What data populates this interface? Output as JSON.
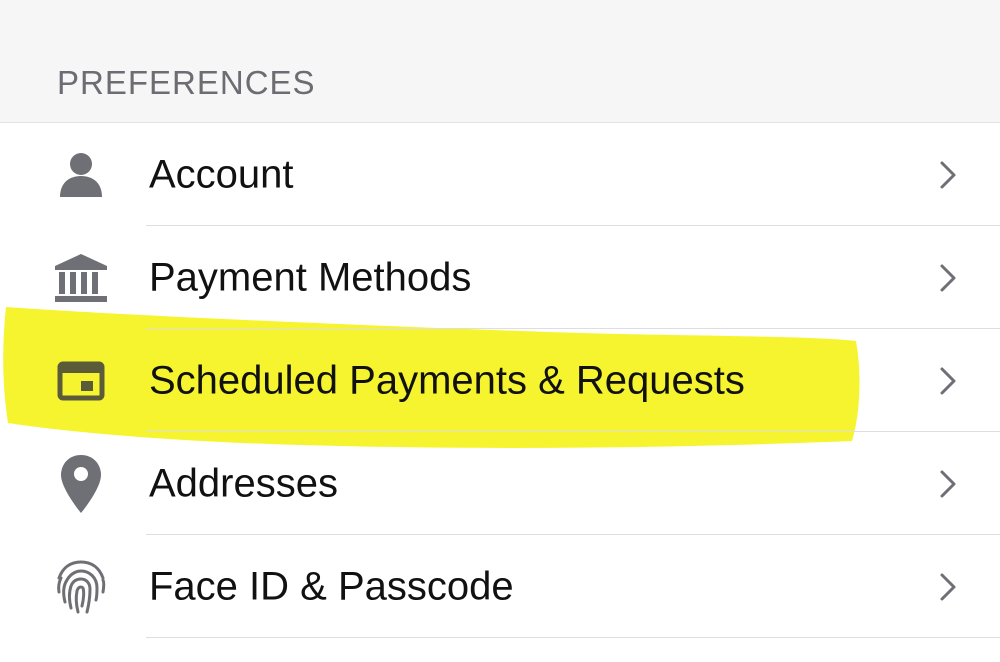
{
  "section": {
    "title": "PREFERENCES"
  },
  "rows": [
    {
      "label": "Account",
      "icon": "person-icon"
    },
    {
      "label": "Payment Methods",
      "icon": "bank-icon"
    },
    {
      "label": "Scheduled Payments & Requests",
      "icon": "calendar-card-icon"
    },
    {
      "label": "Addresses",
      "icon": "location-pin-icon"
    },
    {
      "label": "Face ID & Passcode",
      "icon": "fingerprint-icon"
    }
  ],
  "colors": {
    "icon": "#6f6f76",
    "highlight": "#f4f31c",
    "chevron": "#6f6f76",
    "header_bg": "#f6f6f7",
    "header_text": "#6c6c72"
  }
}
